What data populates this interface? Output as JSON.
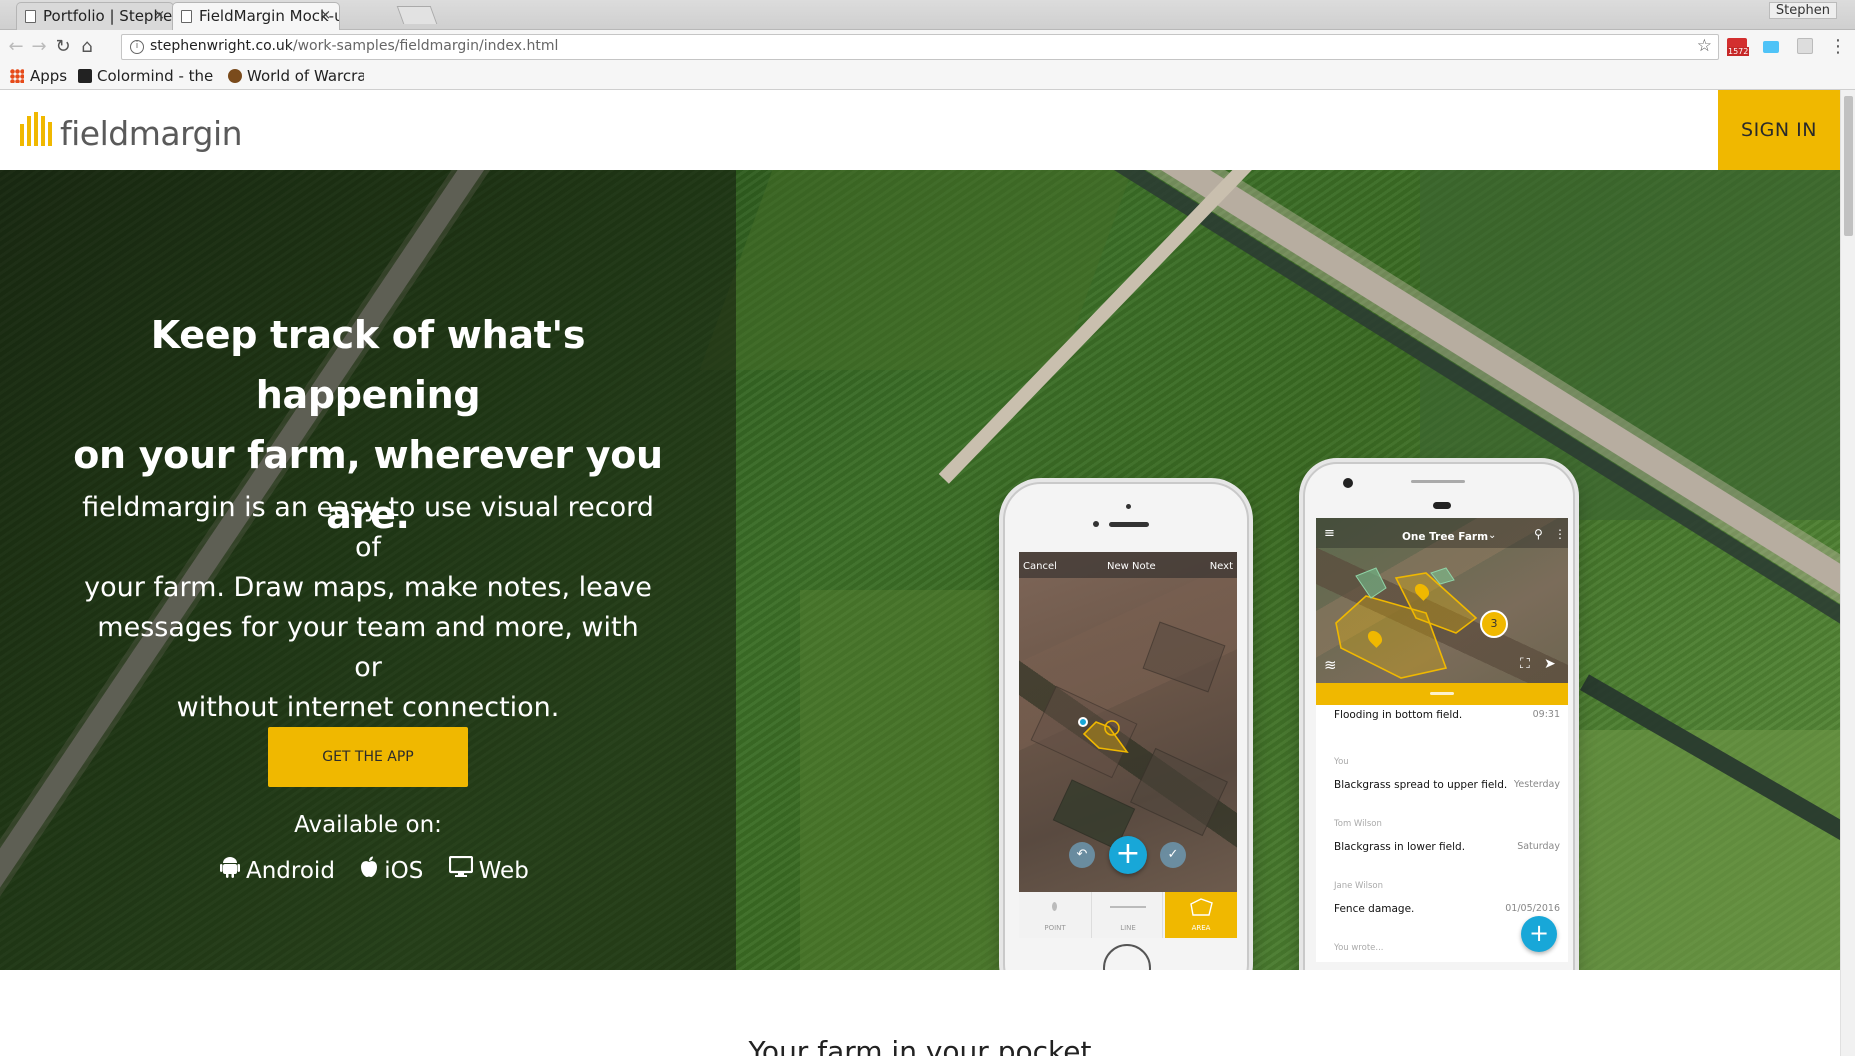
{
  "browser": {
    "tabs": [
      {
        "title": "Portfolio | Stephen",
        "close": "×"
      },
      {
        "title": "FieldMargin Mock-u",
        "close": "×"
      }
    ],
    "profile": "Stephen",
    "url_host": "stephenwright.co.uk",
    "url_path": "/work-samples/fieldmargin/index.html",
    "nav": {
      "back": "←",
      "forward": "→",
      "reload": "↻",
      "home": "⌂",
      "star": "☆",
      "menu": "⋮"
    },
    "gmail_badge": "1572",
    "bookmarks": [
      {
        "label": "Apps",
        "icon": "apps-grid-icon"
      },
      {
        "label": "Colormind - the s",
        "icon": "dice-icon"
      },
      {
        "label": "World of Warcra",
        "icon": "wow-icon"
      }
    ]
  },
  "site": {
    "logo_text": "fieldmargin",
    "sign_in": "SIGN IN",
    "brand_color": "#f0b800"
  },
  "hero": {
    "title_line1": "Keep track of what's happening",
    "title_line2": "on your farm, wherever you are.",
    "desc_line1": "fieldmargin is an easy to use visual record of",
    "desc_line2": "your farm. Draw maps, make notes, leave",
    "desc_line3": "messages for your team and more, with or",
    "desc_line4": "without internet connection.",
    "cta": "GET THE APP",
    "available": "Available on:",
    "platforms": [
      {
        "label": "Android",
        "icon": "android-icon"
      },
      {
        "label": "iOS",
        "icon": "apple-icon"
      },
      {
        "label": "Web",
        "icon": "monitor-icon"
      }
    ]
  },
  "iphone": {
    "cancel": "Cancel",
    "title": "New Note",
    "next": "Next",
    "tabs": [
      "POINT",
      "LINE",
      "AREA"
    ]
  },
  "android": {
    "farm": "One Tree Farm",
    "cluster_count": "3",
    "feed": [
      {
        "author": "",
        "text": "Flooding in bottom field.",
        "time": "09:31"
      },
      {
        "author": "You",
        "text": "Blackgrass spread to upper field.",
        "time": "Yesterday"
      },
      {
        "author": "Tom Wilson",
        "text": "Blackgrass in lower field.",
        "time": "Saturday"
      },
      {
        "author": "Jane Wilson",
        "text": "Fence damage.",
        "time": "01/05/2016"
      },
      {
        "author": "You wrote...",
        "text": "",
        "time": ""
      }
    ]
  },
  "section2": {
    "title": "Your farm in your pocket"
  }
}
